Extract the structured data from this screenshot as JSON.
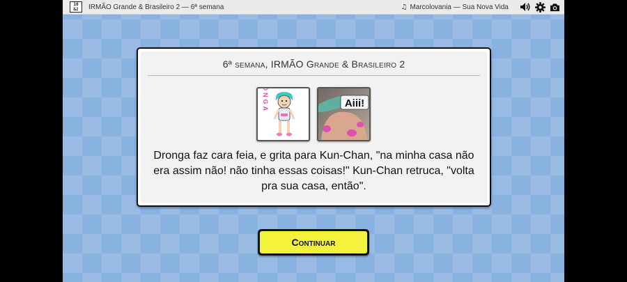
{
  "topbar": {
    "logo_text": "10 &2",
    "title": "IRMÃO Grande & Brasileiro 2 — 6ª semana",
    "now_playing": "Marcolovania — Sua Nova Vida",
    "icons": [
      "music-icon",
      "volume-icon",
      "settings-gear-icon",
      "camera-icon"
    ]
  },
  "dialog": {
    "title": "6ª semana, IRMÃO Grande & Brasileiro 2",
    "cards": [
      {
        "caption": "DRONGA"
      },
      {
        "caption": "Aiii!"
      }
    ],
    "message": "Dronga faz cara feia, e grita para Kun-Chan, \"na minha casa não era assim não! não tinha essas coisas!\" Kun-Chan retruca, \"volta pra sua casa, então\"."
  },
  "continue_button": {
    "label": "Continuar"
  },
  "colors": {
    "background": "#8ab2e0",
    "button_face": "#f3f23a",
    "dialog_bg": "#f2f2f2"
  }
}
